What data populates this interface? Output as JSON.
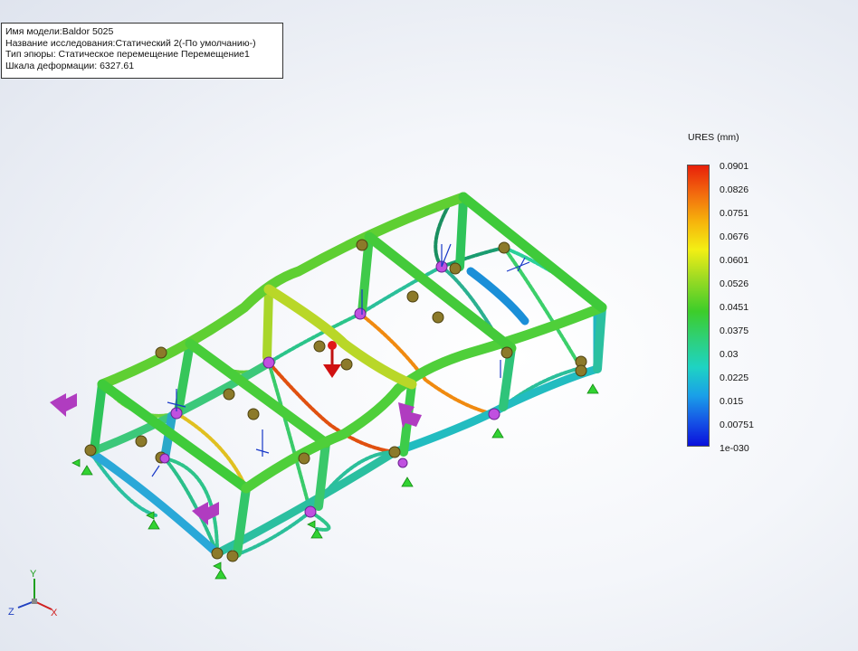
{
  "info": {
    "model_name": "Имя модели:Baldor 5025",
    "study_name": "Название исследования:Статический 2(-По умолчанию-)",
    "plot_type": "Тип эпюры: Статическое перемещение Перемещение1",
    "deformation_scale": "Шкала деформации: 6327.61"
  },
  "legend": {
    "title": "URES (mm)",
    "ticks": [
      "0.0901",
      "0.0826",
      "0.0751",
      "0.0676",
      "0.0601",
      "0.0526",
      "0.0451",
      "0.0375",
      "0.03",
      "0.0225",
      "0.015",
      "0.00751",
      "1e-030"
    ],
    "colors": [
      "#e8200a",
      "#0a10dc"
    ]
  },
  "triad": {
    "x": "X",
    "y": "Y",
    "z": "Z"
  },
  "icons": [
    "fixture-arrow-icon",
    "load-arrow-icon",
    "pin-sphere-icon",
    "axis-triad-icon"
  ]
}
